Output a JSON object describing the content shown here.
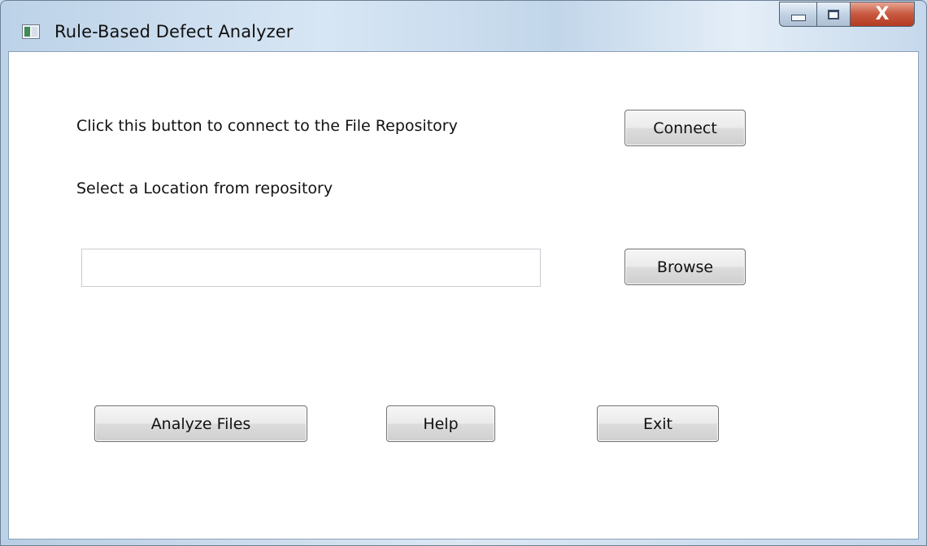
{
  "window": {
    "title": "Rule-Based Defect Analyzer",
    "close_glyph": "X"
  },
  "main": {
    "connect_prompt": "Click this button to connect to the File Repository",
    "connect_label": "Connect",
    "location_prompt": "Select a Location from repository",
    "location_value": "",
    "location_placeholder": "",
    "browse_label": "Browse",
    "analyze_label": "Analyze Files",
    "help_label": "Help",
    "exit_label": "Exit"
  },
  "icons": {
    "app": "app-window-icon",
    "minimize": "minimize-icon",
    "maximize": "maximize-icon",
    "close": "close-icon"
  },
  "colors": {
    "close_button": "#c7583f",
    "frame": "#c9d9ea"
  }
}
